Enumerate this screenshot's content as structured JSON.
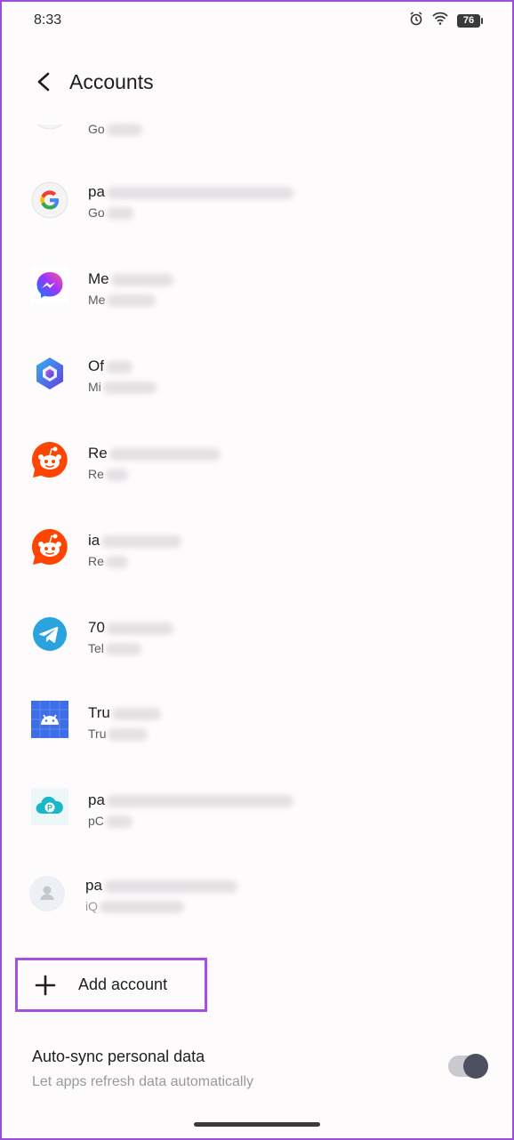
{
  "status_bar": {
    "time": "8:33",
    "battery": "76",
    "icons": [
      "alarm-icon",
      "wifi-icon",
      "battery-icon"
    ]
  },
  "header": {
    "title": "Accounts",
    "back_icon": "arrow-left-icon"
  },
  "accounts": [
    {
      "icon": "google-icon",
      "title": "",
      "sub": "Go"
    },
    {
      "icon": "google-icon",
      "title": "pa",
      "sub": "Go"
    },
    {
      "icon": "messenger-icon",
      "title": "Me",
      "sub": "Me"
    },
    {
      "icon": "office-icon",
      "title": "Of",
      "sub": "Mi"
    },
    {
      "icon": "reddit-icon",
      "title": "Re",
      "sub": "Re"
    },
    {
      "icon": "reddit-icon",
      "title": "ia",
      "sub": "Re"
    },
    {
      "icon": "telegram-icon",
      "title": "70",
      "sub": "Tel"
    },
    {
      "icon": "truecaller-icon",
      "title": "Tru",
      "sub": "Tru"
    },
    {
      "icon": "pcloud-icon",
      "title": "pa",
      "sub": "pC"
    },
    {
      "icon": "person-icon",
      "title": "pa",
      "sub": "iQ"
    }
  ],
  "add_account": {
    "label": "Add account",
    "icon": "plus-icon"
  },
  "auto_sync": {
    "title": "Auto-sync personal data",
    "description": "Let apps refresh data automatically",
    "enabled": true
  },
  "colors": {
    "highlight": "#a64fe0",
    "reddit": "#ff4500",
    "telegram": "#2aa3df",
    "truecaller": "#3d6ee8",
    "pcloud": "#19b7c9"
  }
}
